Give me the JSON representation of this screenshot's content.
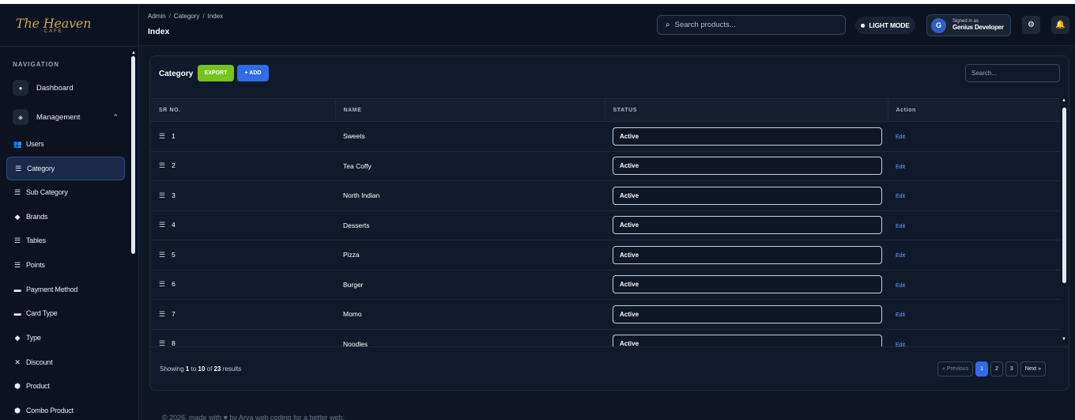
{
  "brand": {
    "name": "The Heaven",
    "sub": "CAFE"
  },
  "sidebar": {
    "title": "NAVIGATION",
    "items": [
      {
        "label": "Dashboard",
        "icon": "dashboard-icon"
      },
      {
        "label": "Management",
        "icon": "layers-icon"
      }
    ],
    "sub_items": [
      {
        "label": "Users",
        "icon": "users-icon"
      },
      {
        "label": "Category",
        "icon": "list-icon"
      },
      {
        "label": "Sub Category",
        "icon": "list-icon"
      },
      {
        "label": "Brands",
        "icon": "tag-icon"
      },
      {
        "label": "Tables",
        "icon": "list-icon"
      },
      {
        "label": "Points",
        "icon": "list-icon"
      },
      {
        "label": "Payment Method",
        "icon": "card-icon"
      },
      {
        "label": "Card Type",
        "icon": "card-icon"
      },
      {
        "label": "Type",
        "icon": "tag-icon"
      },
      {
        "label": "Discount",
        "icon": "percent-icon"
      },
      {
        "label": "Product",
        "icon": "box-icon"
      },
      {
        "label": "Combo Product",
        "icon": "box-icon"
      }
    ]
  },
  "header": {
    "breadcrumb": [
      "Admin",
      "Category",
      "Index"
    ],
    "title": "Index",
    "search_placeholder": "Search products...",
    "light_mode_label": "LIGHT MODE",
    "user": {
      "initial": "G",
      "signed_in_label": "Signed in as",
      "name": "Genius Developer"
    }
  },
  "card": {
    "label": "Category",
    "export_label": "EXPORT",
    "add_label": "+ ADD",
    "search_placeholder": "Search...",
    "columns": [
      "SR NO.",
      "NAME",
      "STATUS",
      "Action"
    ],
    "rows": [
      {
        "sr": "1",
        "name": "Sweets",
        "status": "Active",
        "action": "Edit"
      },
      {
        "sr": "2",
        "name": "Tea Coffy",
        "status": "Active",
        "action": "Edit"
      },
      {
        "sr": "3",
        "name": "North Indian",
        "status": "Active",
        "action": "Edit"
      },
      {
        "sr": "4",
        "name": "Desserts",
        "status": "Active",
        "action": "Edit"
      },
      {
        "sr": "5",
        "name": "Pizza",
        "status": "Active",
        "action": "Edit"
      },
      {
        "sr": "6",
        "name": "Burger",
        "status": "Active",
        "action": "Edit"
      },
      {
        "sr": "7",
        "name": "Momo",
        "status": "Active",
        "action": "Edit"
      },
      {
        "sr": "8",
        "name": "Noodles",
        "status": "Active",
        "action": "Edit"
      }
    ],
    "showing": {
      "prefix": "Showing",
      "from": "1",
      "to_word": "to",
      "to": "10",
      "of_word": "of",
      "total": "23",
      "suffix": "results"
    },
    "pager": {
      "prev": "« Previous",
      "pages": [
        "1",
        "2",
        "3"
      ],
      "next": "Next »",
      "current": "1"
    }
  },
  "footer": "© 2026, made with ♥ by Arya web coding for a better web."
}
